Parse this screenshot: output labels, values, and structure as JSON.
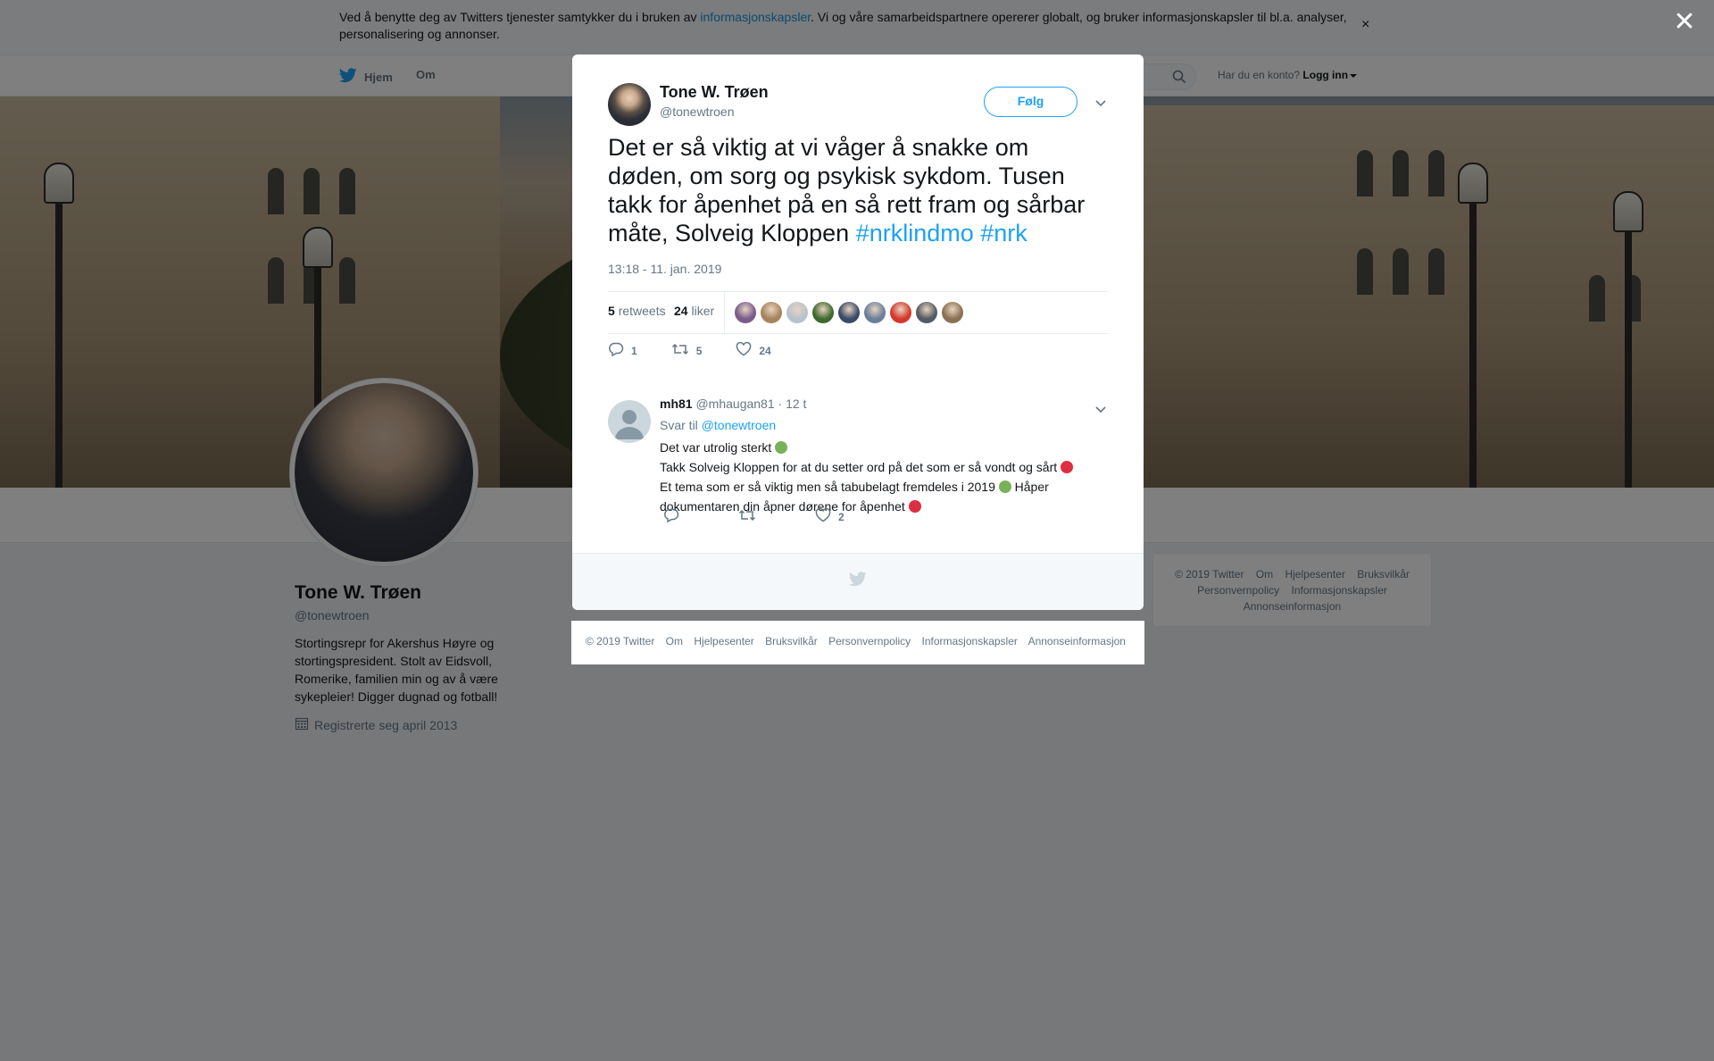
{
  "cookie_banner": {
    "text_before": "Ved å benytte deg av Twitters tjenester samtykker du i bruken av ",
    "link": "informasjonskapsler",
    "text_after": ". Vi og våre samarbeidspartnere opererer globalt, og bruker informasjonskapsler til bl.a. analyser, personalisering og annonser.",
    "close": "×"
  },
  "modal_close": "✕",
  "nav": {
    "home": "Hjem",
    "about": "Om",
    "account_prompt": "Har du en konto?",
    "login": "Logg inn"
  },
  "profile": {
    "name": "Tone W. Trøen",
    "handle": "@tonewtroen",
    "bio": "Stortingsrepr for Akershus Høyre og stortingspresident. Stolt av Eidsvoll, Romerike, familien min og av å være sykepleier! Digger dugnad og fotball!",
    "joined": "Registrerte seg april 2013"
  },
  "side_footer": {
    "links": [
      "© 2019 Twitter",
      "Om",
      "Hjelpesenter",
      "Bruksvilkår",
      "Personvernpolicy",
      "Informasjonskapsler",
      "Annonseinformasjon"
    ]
  },
  "tweet": {
    "name": "Tone W. Trøen",
    "handle": "@tonewtroen",
    "follow": "Følg",
    "text": "Det er så viktig at vi våger å snakke om døden, om sorg og psykisk sykdom. Tusen takk for åpenhet på en så rett fram og sårbar måte, Solveig Kloppen ",
    "hashtags": [
      "#nrklindmo",
      "#nrk"
    ],
    "time": "13:18 - 11. jan. 2019",
    "retweets_count": "5",
    "retweets_label": "retweets",
    "likes_count": "24",
    "likes_label": "liker",
    "reply_count": "1",
    "retweet_count": "5",
    "like_count": "24",
    "liker_colors": [
      "#7a5c8c",
      "#a8845c",
      "#b8c2cc",
      "#3f6a2f",
      "#3b4a66",
      "#6b7f9a",
      "#d33a2c",
      "#555b63",
      "#8a7152"
    ]
  },
  "reply": {
    "name": "mh81",
    "handle": "@mhaugan81",
    "time": "· 12 t",
    "reply_to_label": "Svar til",
    "reply_to": "@tonewtroen",
    "line1": "Det var utrolig sterkt",
    "line2": "Takk Solveig Kloppen for at du setter ord på det som er så vondt og sårt",
    "line3": " Et tema som er så viktig men så tabubelagt fremdeles i 2019",
    "line3b": " Håper dokumentaren din åpner dørene for åpenhet",
    "like_count": "2",
    "green_heart_color": "#78b159",
    "red_heart_color": "#dd2e44"
  },
  "modal_footer": {
    "links": [
      "© 2019 Twitter",
      "Om",
      "Hjelpesenter",
      "Bruksvilkår",
      "Personvernpolicy",
      "Informasjonskapsler",
      "Annonseinformasjon"
    ]
  }
}
